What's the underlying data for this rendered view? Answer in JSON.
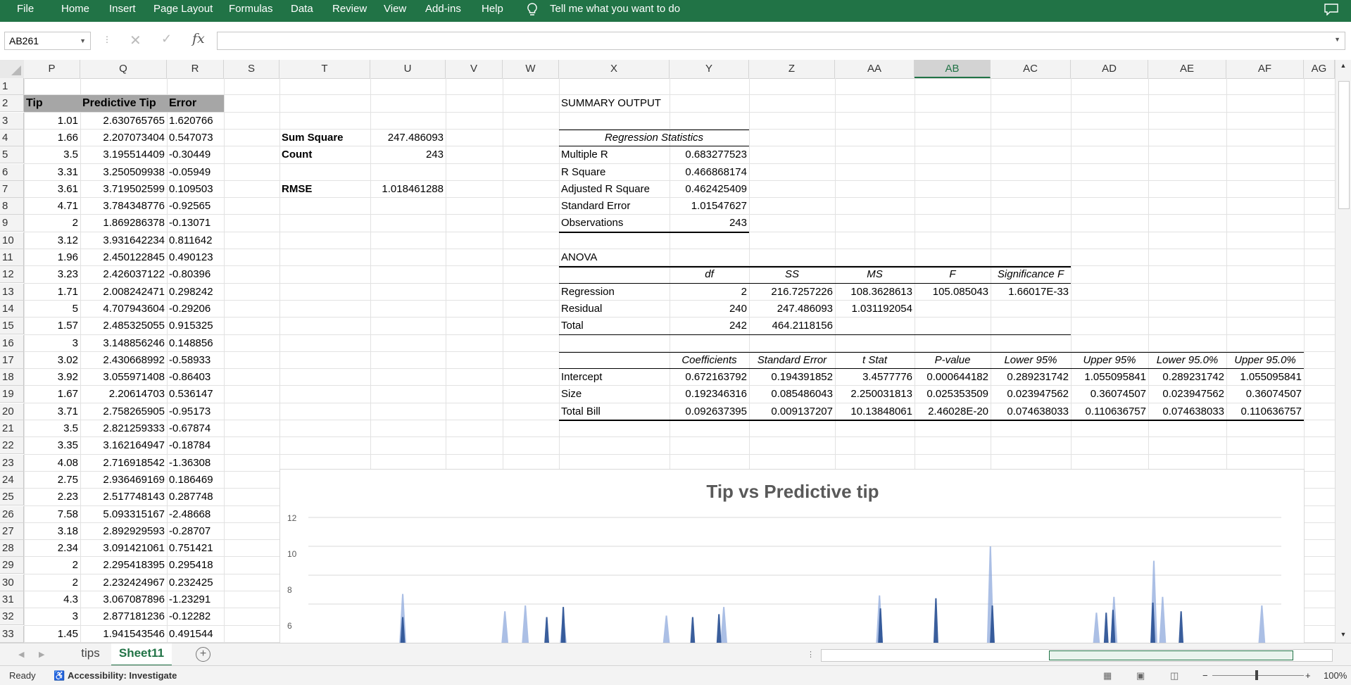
{
  "ribbon": {
    "tabs": [
      "File",
      "Home",
      "Insert",
      "Page Layout",
      "Formulas",
      "Data",
      "Review",
      "View",
      "Add-ins",
      "Help"
    ],
    "tell_me": "Tell me what you want to do",
    "bg_color": "#217346"
  },
  "formula_bar": {
    "name_box": "AB261",
    "formula": ""
  },
  "columns": [
    "P",
    "Q",
    "R",
    "S",
    "T",
    "U",
    "V",
    "W",
    "X",
    "Y",
    "Z",
    "AA",
    "AB",
    "AC",
    "AD",
    "AE",
    "AF",
    "AG"
  ],
  "selected_column": "AB",
  "rows": [
    "1",
    "2",
    "3",
    "4",
    "5",
    "6",
    "7",
    "8",
    "9",
    "10",
    "11",
    "12",
    "13",
    "14",
    "15",
    "16",
    "17",
    "18",
    "19",
    "20",
    "21",
    "22",
    "23",
    "24",
    "25",
    "26",
    "27",
    "28",
    "29",
    "30",
    "31",
    "32",
    "33"
  ],
  "data_table": {
    "headers": [
      "Tip",
      "Predictive Tip",
      "Error"
    ],
    "rows": [
      [
        "1.01",
        "2.630765765",
        "1.620766"
      ],
      [
        "1.66",
        "2.207073404",
        "0.547073"
      ],
      [
        "3.5",
        "3.195514409",
        "-0.30449"
      ],
      [
        "3.31",
        "3.250509938",
        "-0.05949"
      ],
      [
        "3.61",
        "3.719502599",
        "0.109503"
      ],
      [
        "4.71",
        "3.784348776",
        "-0.92565"
      ],
      [
        "2",
        "1.869286378",
        "-0.13071"
      ],
      [
        "3.12",
        "3.931642234",
        "0.811642"
      ],
      [
        "1.96",
        "2.450122845",
        "0.490123"
      ],
      [
        "3.23",
        "2.426037122",
        "-0.80396"
      ],
      [
        "1.71",
        "2.008242471",
        "0.298242"
      ],
      [
        "5",
        "4.707943604",
        "-0.29206"
      ],
      [
        "1.57",
        "2.485325055",
        "0.915325"
      ],
      [
        "3",
        "3.148856246",
        "0.148856"
      ],
      [
        "3.02",
        "2.430668992",
        "-0.58933"
      ],
      [
        "3.92",
        "3.055971408",
        "-0.86403"
      ],
      [
        "1.67",
        "2.20614703",
        "0.536147"
      ],
      [
        "3.71",
        "2.758265905",
        "-0.95173"
      ],
      [
        "3.5",
        "2.821259333",
        "-0.67874"
      ],
      [
        "3.35",
        "3.162164947",
        "-0.18784"
      ],
      [
        "4.08",
        "2.716918542",
        "-1.36308"
      ],
      [
        "2.75",
        "2.936469169",
        "0.186469"
      ],
      [
        "2.23",
        "2.517748143",
        "0.287748"
      ],
      [
        "7.58",
        "5.093315167",
        "-2.48668"
      ],
      [
        "3.18",
        "2.892929593",
        "-0.28707"
      ],
      [
        "2.34",
        "3.091421061",
        "0.751421"
      ],
      [
        "2",
        "2.295418395",
        "0.295418"
      ],
      [
        "2",
        "2.232424967",
        "0.232425"
      ],
      [
        "4.3",
        "3.067087896",
        "-1.23291"
      ],
      [
        "3",
        "2.877181236",
        "-0.12282"
      ],
      [
        "1.45",
        "1.941543546",
        "0.491544"
      ]
    ]
  },
  "metrics": {
    "sum_square_label": "Sum Square",
    "sum_square": "247.486093",
    "count_label": "Count",
    "count": "243",
    "rmse_label": "RMSE",
    "rmse": "1.018461288"
  },
  "summary": {
    "title": "SUMMARY OUTPUT",
    "regression_stats_header": "Regression Statistics",
    "stats": [
      [
        "Multiple R",
        "0.683277523"
      ],
      [
        "R Square",
        "0.466868174"
      ],
      [
        "Adjusted R Square",
        "0.462425409"
      ],
      [
        "Standard Error",
        "1.01547627"
      ],
      [
        "Observations",
        "243"
      ]
    ],
    "anova_title": "ANOVA",
    "anova_headers": [
      "df",
      "SS",
      "MS",
      "F",
      "Significance F"
    ],
    "anova_rows": [
      [
        "Regression",
        "2",
        "216.7257226",
        "108.3628613",
        "105.085043",
        "1.66017E-33"
      ],
      [
        "Residual",
        "240",
        "247.486093",
        "1.031192054",
        "",
        ""
      ],
      [
        "Total",
        "242",
        "464.2118156",
        "",
        "",
        ""
      ]
    ],
    "coef_headers": [
      "Coefficients",
      "Standard Error",
      "t Stat",
      "P-value",
      "Lower 95%",
      "Upper 95%",
      "Lower 95.0%",
      "Upper 95.0%"
    ],
    "coef_rows": [
      [
        "Intercept",
        "0.672163792",
        "0.194391852",
        "3.4577776",
        "0.000644182",
        "0.289231742",
        "1.055095841",
        "0.289231742",
        "1.055095841"
      ],
      [
        "Size",
        "0.192346316",
        "0.085486043",
        "2.250031813",
        "0.025353509",
        "0.023947562",
        "0.36074507",
        "0.023947562",
        "0.36074507"
      ],
      [
        "Total Bill",
        "0.092637395",
        "0.009137207",
        "10.13848061",
        "2.46028E-20",
        "0.074638033",
        "0.110636757",
        "0.074638033",
        "0.110636757"
      ]
    ]
  },
  "chart_data": {
    "type": "area",
    "title": "Tip vs Predictive tip",
    "yticks": [
      "12",
      "10",
      "8",
      "6"
    ],
    "ylim": [
      0,
      13
    ],
    "series": [
      {
        "color": "#8faadc",
        "peaks": [
          [
            0.097,
            6.7
          ],
          [
            0.202,
            5.5
          ],
          [
            0.223,
            5.9
          ],
          [
            0.262,
            5.2
          ],
          [
            0.368,
            5.2
          ],
          [
            0.427,
            5.8
          ],
          [
            0.587,
            6.6
          ],
          [
            0.701,
            10.0
          ],
          [
            0.81,
            5.4
          ],
          [
            0.828,
            6.5
          ],
          [
            0.869,
            9.0
          ],
          [
            0.878,
            6.5
          ],
          [
            0.98,
            5.9
          ]
        ]
      },
      {
        "color": "#2f5597",
        "peaks": [
          [
            0.097,
            5.1
          ],
          [
            0.245,
            5.1
          ],
          [
            0.262,
            5.8
          ],
          [
            0.395,
            5.1
          ],
          [
            0.422,
            5.3
          ],
          [
            0.588,
            5.7
          ],
          [
            0.645,
            6.4
          ],
          [
            0.703,
            5.9
          ],
          [
            0.827,
            5.6
          ],
          [
            0.82,
            5.4
          ],
          [
            0.868,
            6.1
          ],
          [
            0.897,
            5.5
          ]
        ]
      }
    ]
  },
  "sheet_tabs": [
    "tips",
    "Sheet11"
  ],
  "active_sheet": "Sheet11",
  "status": {
    "ready": "Ready",
    "accessibility": "Accessibility: Investigate",
    "zoom": "100%"
  }
}
